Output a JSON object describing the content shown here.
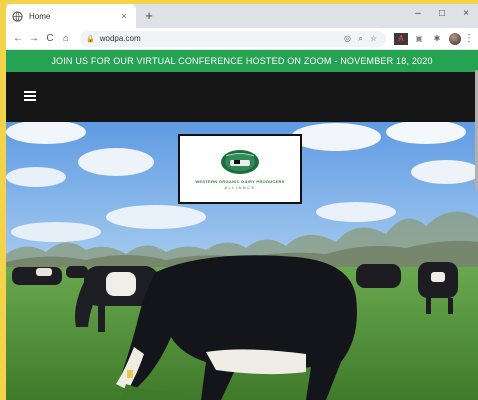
{
  "browser": {
    "tab_title": "Home",
    "tab_close": "×",
    "new_tab": "+",
    "minimize": "–",
    "maximize": "□",
    "close_window": "×",
    "back": "←",
    "forward": "→",
    "reload": "C",
    "home": "⌂",
    "url": "wodpa.com",
    "lock": "🔒",
    "menu": "⋮"
  },
  "site": {
    "announcement": "JOIN US FOR OUR VIRTUAL CONFERENCE HOSTED ON ZOOM - NOVEMBER 18, 2020",
    "logo_org": "WESTERN ORGANIC DAIRY PRODUCERS",
    "logo_sub": "ALLIANCE"
  },
  "colors": {
    "banner": "#25a352",
    "navbar": "#161616",
    "page_border": "#f3d34a"
  }
}
